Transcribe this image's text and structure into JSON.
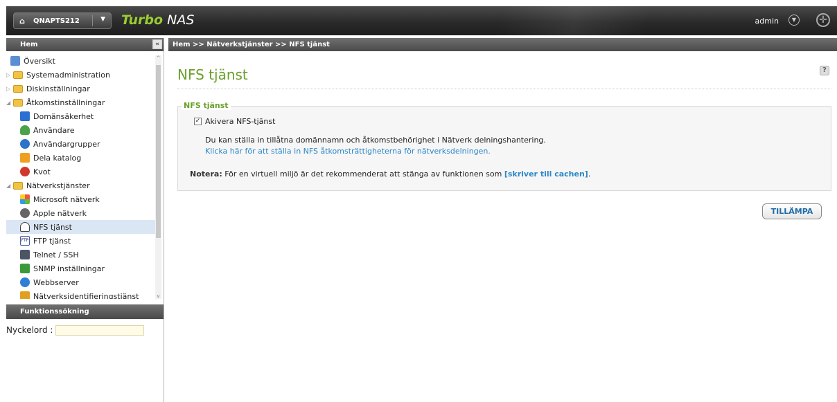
{
  "topbar": {
    "host": "QNAPTS212",
    "brand_a": "Turbo",
    "brand_b": "NAS",
    "user": "admin"
  },
  "nav": {
    "header": "Hem",
    "items": [
      {
        "label": "Översikt",
        "icon": "overview-icon"
      },
      {
        "label": "Systemadministration",
        "icon": "folder-icon"
      },
      {
        "label": "Diskinställningar",
        "icon": "folder-icon"
      },
      {
        "label": "Åtkomstinställningar",
        "icon": "folder-open-icon"
      },
      {
        "label": "Domänsäkerhet",
        "icon": "domain-security-icon"
      },
      {
        "label": "Användare",
        "icon": "user-icon"
      },
      {
        "label": "Användargrupper",
        "icon": "user-group-icon"
      },
      {
        "label": "Dela katalog",
        "icon": "share-folder-icon"
      },
      {
        "label": "Kvot",
        "icon": "quota-icon"
      },
      {
        "label": "Nätverkstjänster",
        "icon": "folder-open-icon"
      },
      {
        "label": "Microsoft nätverk",
        "icon": "microsoft-icon"
      },
      {
        "label": "Apple nätverk",
        "icon": "apple-icon"
      },
      {
        "label": "NFS tjänst",
        "icon": "nfs-icon",
        "selected": true
      },
      {
        "label": "FTP tjänst",
        "icon": "ftp-icon"
      },
      {
        "label": "Telnet / SSH",
        "icon": "telnet-icon"
      },
      {
        "label": "SNMP inställningar",
        "icon": "snmp-icon"
      },
      {
        "label": "Webbserver",
        "icon": "web-server-icon"
      },
      {
        "label": "Nätverksidentifieringstjänst",
        "icon": "network-discovery-icon"
      }
    ]
  },
  "search": {
    "header": "Funktionssökning",
    "label": "Nyckelord :",
    "value": ""
  },
  "breadcrumb": "Hem >> Nätverkstjänster >> NFS tjänst",
  "main": {
    "title": "NFS tjänst",
    "section_title": "NFS tjänst",
    "enable_label": "Akivera NFS-tjänst",
    "enable_checked": true,
    "info_text": "Du kan ställa in tillåtna domännamn och åtkomstbehörighet i Nätverk delningshantering.",
    "link_text": "Klicka här för att ställa in NFS åtkomsträttigheterna för nätverksdelningen.",
    "note_label": "Notera:",
    "note_text": "För en virtuell miljö är det rekommenderat att stänga av funktionen som",
    "note_link": "[skriver till cachen]",
    "note_end": ".",
    "apply_label": "TILLÄMPA"
  },
  "colors": {
    "accent_green": "#6aa02a",
    "link_blue": "#2a87c8",
    "selection": "#dbe6f4"
  }
}
